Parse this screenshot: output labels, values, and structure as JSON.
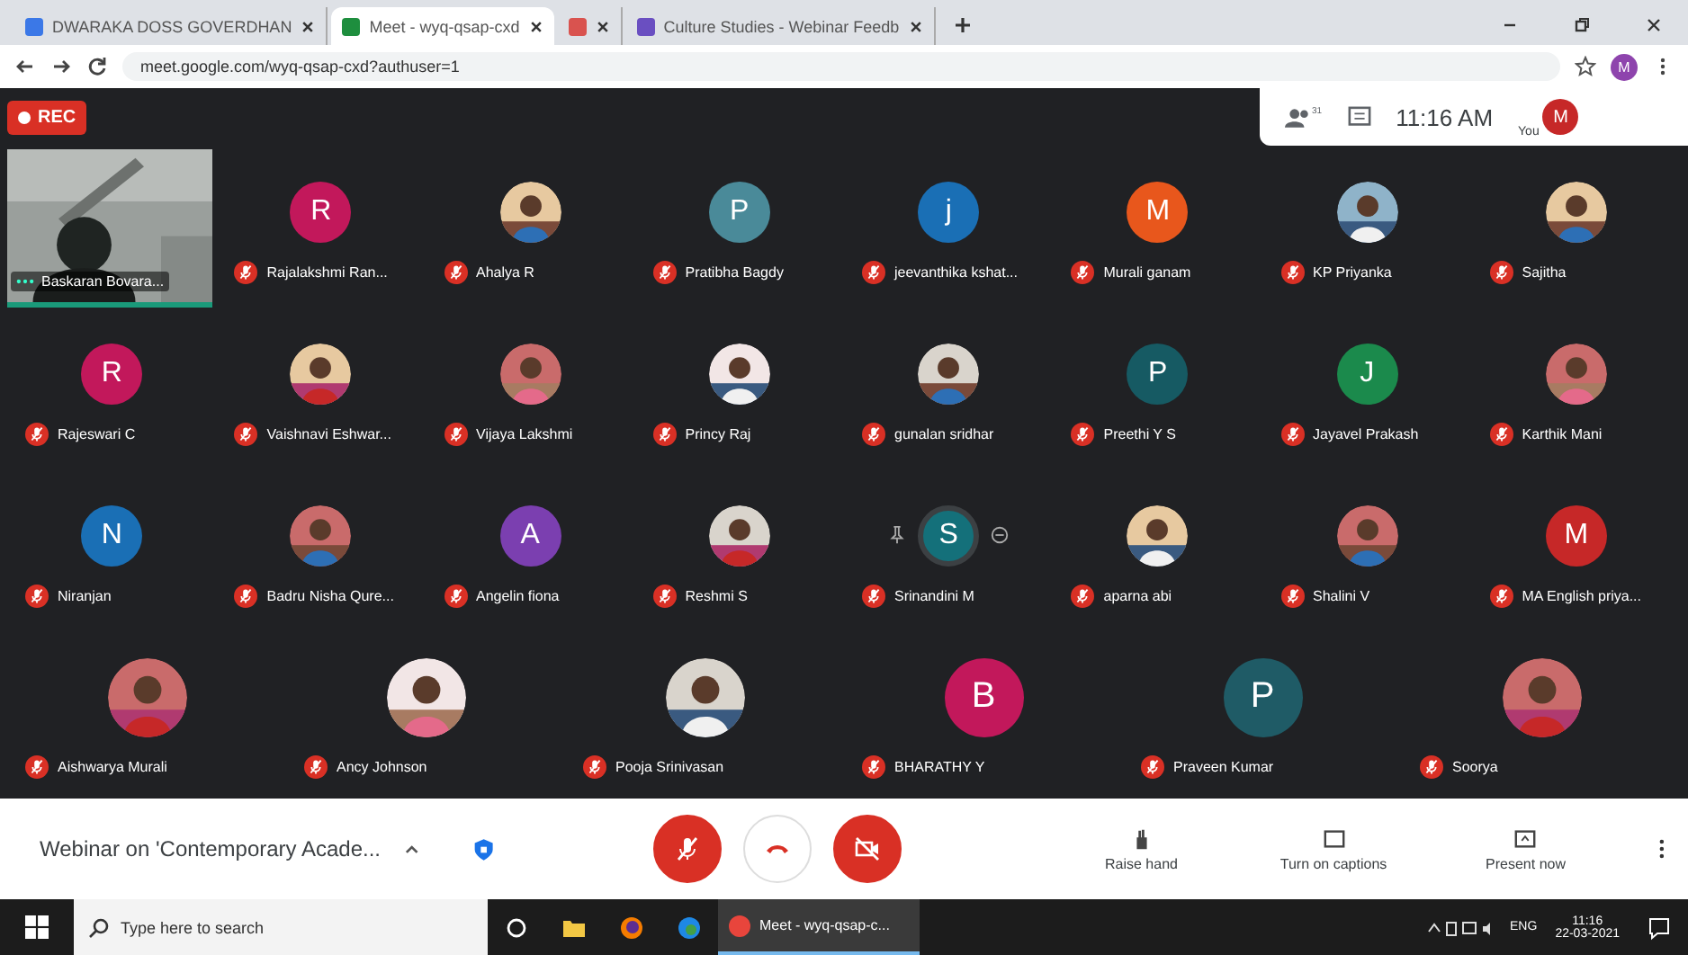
{
  "browser": {
    "tabs": [
      {
        "title": "DWARAKA DOSS GOVERDHAN",
        "selected": false
      },
      {
        "title": "Meet - wyq-qsap-cxd",
        "selected": true
      },
      {
        "selected": false
      },
      {
        "title": "Culture Studies - Webinar Feedb",
        "selected": false
      }
    ],
    "url": "meet.google.com/wyq-qsap-cxd?authuser=1",
    "profile": "M"
  },
  "meeting": {
    "recording": "REC",
    "people_count": "31",
    "time": "11:16 AM",
    "self_label": "You",
    "self_initial": "M",
    "grid_rows": [
      [
        {
          "name": "Baskaran Bovara...",
          "kind": "video",
          "speaking": true
        },
        {
          "name": "Rajalakshmi Ran...",
          "kind": "letter",
          "letter": "R",
          "color": "#c2185b",
          "muted": true,
          "hovered": false
        },
        {
          "name": "Ahalya R",
          "muted": true,
          "hovered": false
        },
        {
          "name": "Pratibha Bagdy",
          "kind": "letter",
          "letter": "P",
          "color": "#4a8a99",
          "muted": true,
          "hovered": false
        },
        {
          "name": "jeevanthika kshat...",
          "kind": "letter",
          "letter": "j",
          "color": "#1a6fb5",
          "muted": true,
          "hovered": false
        },
        {
          "name": "Murali ganam",
          "kind": "letter",
          "letter": "M",
          "color": "#e8571c",
          "muted": true,
          "hovered": false
        },
        {
          "name": "KP Priyanka",
          "muted": true,
          "hovered": false
        },
        {
          "name": "Sajitha",
          "muted": true,
          "hovered": false
        }
      ],
      [
        {
          "name": "Rajeswari C",
          "kind": "letter",
          "letter": "R",
          "color": "#c2185b",
          "muted": true,
          "hovered": false
        },
        {
          "name": "Vaishnavi Eshwar...",
          "muted": true,
          "hovered": false
        },
        {
          "name": "Vijaya Lakshmi",
          "muted": true,
          "hovered": false
        },
        {
          "name": "Princy Raj",
          "muted": true,
          "hovered": false
        },
        {
          "name": "gunalan sridhar",
          "muted": true,
          "hovered": false
        },
        {
          "name": "Preethi Y S",
          "kind": "letter",
          "letter": "P",
          "color": "#165a63",
          "muted": true,
          "hovered": false
        },
        {
          "name": "Jayavel Prakash",
          "kind": "letter",
          "letter": "J",
          "color": "#1b8a4c",
          "muted": true,
          "hovered": false
        },
        {
          "name": "Karthik Mani",
          "muted": true,
          "hovered": false
        }
      ],
      [
        {
          "name": "Niranjan",
          "kind": "letter",
          "letter": "N",
          "color": "#1a6fb5",
          "muted": true,
          "hovered": false
        },
        {
          "name": "Badru Nisha Qure...",
          "muted": true,
          "hovered": false
        },
        {
          "name": "Angelin fiona",
          "kind": "letter",
          "letter": "A",
          "color": "#7b3fb0",
          "muted": true,
          "hovered": false
        },
        {
          "name": "Reshmi S",
          "muted": true,
          "hovered": false
        },
        {
          "name": "Srinandini M",
          "kind": "letter",
          "letter": "S",
          "color": "#14707a",
          "muted": true,
          "hovered": true
        },
        {
          "name": "aparna abi",
          "muted": true,
          "hovered": false
        },
        {
          "name": "Shalini V",
          "muted": true,
          "hovered": false
        },
        {
          "name": "MA English priya...",
          "kind": "letter",
          "letter": "M",
          "color": "#c62828",
          "muted": true,
          "hovered": false
        }
      ],
      [
        {
          "name": "Aishwarya Murali",
          "muted": true,
          "hovered": false
        },
        {
          "name": "Ancy Johnson",
          "muted": true,
          "hovered": false
        },
        {
          "name": "Pooja Srinivasan",
          "muted": true,
          "hovered": false
        },
        {
          "name": "BHARATHY Y",
          "kind": "letter",
          "letter": "B",
          "color": "#c2185b",
          "muted": true,
          "hovered": false
        },
        {
          "name": "Praveen Kumar",
          "kind": "letter",
          "letter": "P",
          "color": "#1f5b66",
          "muted": true,
          "hovered": false
        },
        {
          "name": "Soorya",
          "muted": true,
          "hovered": false
        }
      ]
    ]
  },
  "controls": {
    "meeting_title": "Webinar on 'Contemporary Acade...",
    "mic_on": false,
    "camera_on": false,
    "actions": [
      "Raise hand",
      "Turn on captions",
      "Present now"
    ]
  },
  "taskbar": {
    "search_placeholder": "Type here to search",
    "app": "Meet - wyq-qsap-c...",
    "language": "ENG",
    "time": "11:16",
    "date": "22-03-2021"
  }
}
